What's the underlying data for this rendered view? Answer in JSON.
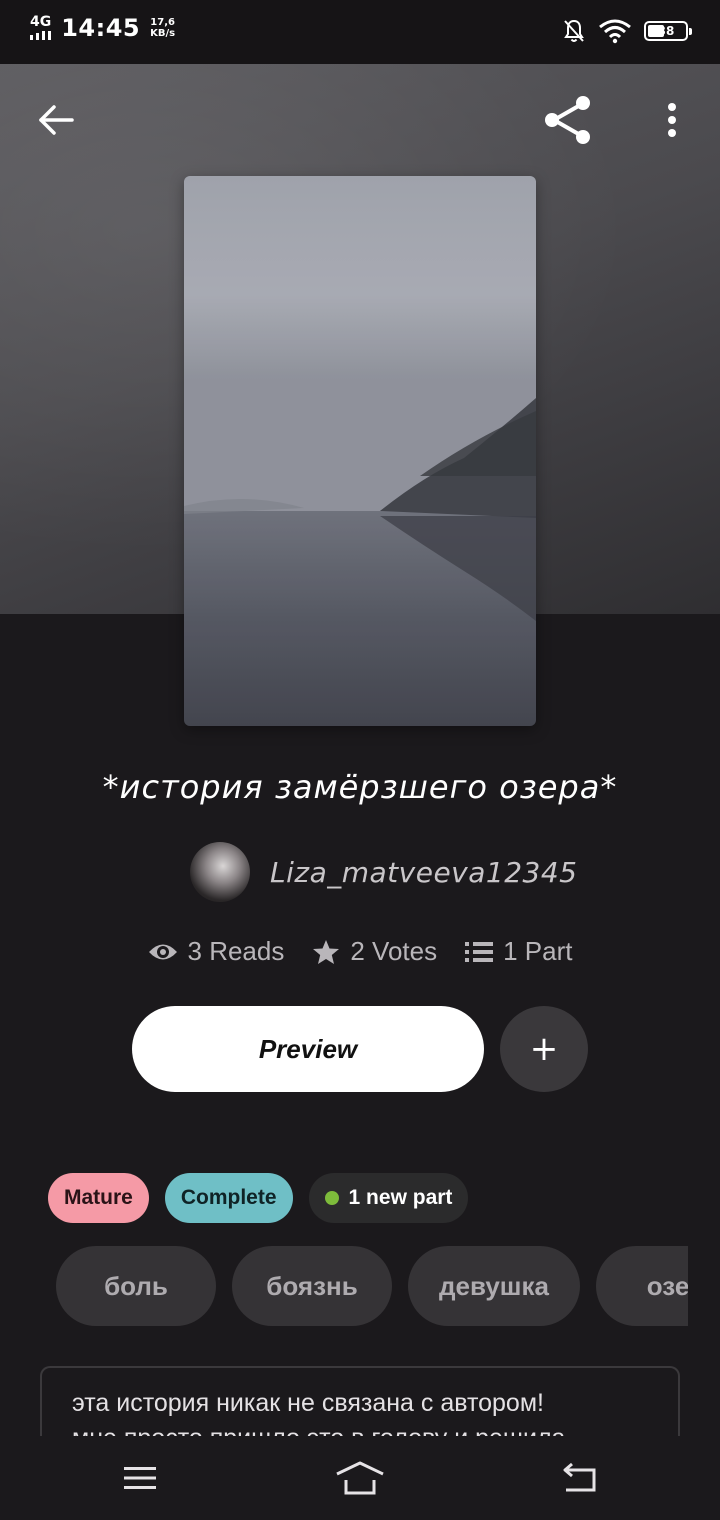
{
  "status_bar": {
    "network": "4G",
    "time": "14:45",
    "speed_value": "17,6",
    "speed_unit": "KB/s",
    "battery": "38",
    "icons": [
      "bell-off-icon",
      "wifi-icon",
      "battery-icon"
    ]
  },
  "header": {
    "back_icon": "arrow-left-icon",
    "share_icon": "share-icon",
    "more_icon": "more-vertical-icon"
  },
  "story": {
    "title": "*история замёрзшего озера*",
    "author": "Liza_matveeva12345",
    "stats": {
      "reads": "3 Reads",
      "votes": "2 Votes",
      "parts": "1 Part"
    }
  },
  "actions": {
    "preview_label": "Preview",
    "add_label": "+"
  },
  "badges": {
    "mature": "Mature",
    "complete": "Complete",
    "new_part": "1 new part"
  },
  "tags": [
    "боль",
    "боязнь",
    "девушка",
    "озер"
  ],
  "description": {
    "line1": "эта история никак не связана с автором!",
    "line2": "мне просто пришло это в голову и решила"
  },
  "navbar": {
    "icons": [
      "menu-icon",
      "home-icon",
      "back-icon"
    ]
  },
  "colors": {
    "mature_badge": "#f59aa6",
    "complete_badge": "#6fbfc6",
    "new_dot": "#7dbb3b",
    "background": "#1b191c"
  }
}
